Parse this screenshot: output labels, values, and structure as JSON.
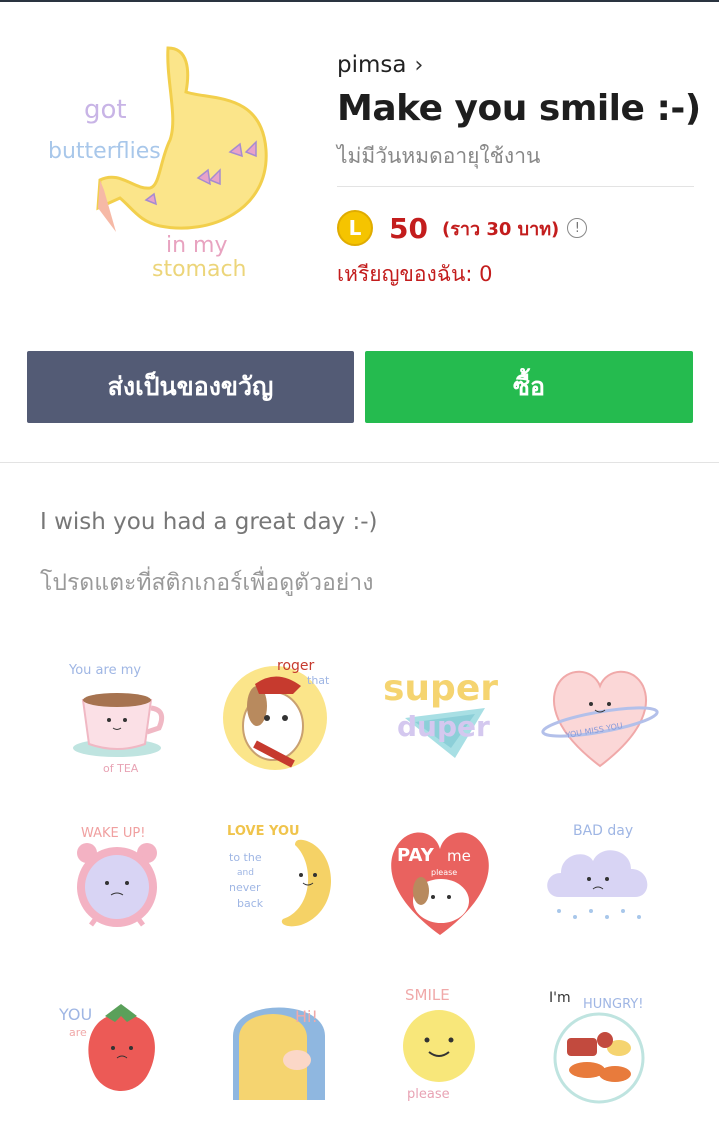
{
  "package": {
    "author": "pimsa",
    "title": "Make you smile :-)",
    "validity": "ไม่มีวันหมดอายุใช้งาน",
    "coin_letter": "L",
    "price": "50",
    "price_approx": "(ราว 30 บาท)",
    "my_coins": "เหรียญของฉัน: 0"
  },
  "cover": {
    "line1": "got",
    "line2": "butterflies",
    "line3": "in my",
    "line4": "stomach"
  },
  "buttons": {
    "gift": "ส่งเป็นของขวัญ",
    "buy": "ซื้อ"
  },
  "description": "I wish you had a great day :-)",
  "tap_hint": "โปรดแตะที่สติกเกอร์เพื่อดูตัวอย่าง",
  "stickers": {
    "s1": "You are my",
    "s1b": "of TEA",
    "s2": "roger",
    "s2b": "that",
    "s3": "super",
    "s3b": "duper",
    "s4": "YOU MISS YOU",
    "s5": "WAKE UP!",
    "s6": "LOVE YOU",
    "s6b": "to the",
    "s6c": "and",
    "s6d": "never",
    "s6e": "back",
    "s7": "PAY",
    "s7b": "me",
    "s7c": "please",
    "s8": "BAD day",
    "s9": "YOU",
    "s9b": "are",
    "s10": "Hi!",
    "s11": "SMILE",
    "s11b": "please",
    "s12": "I'm",
    "s12b": "HUNGRY!"
  }
}
